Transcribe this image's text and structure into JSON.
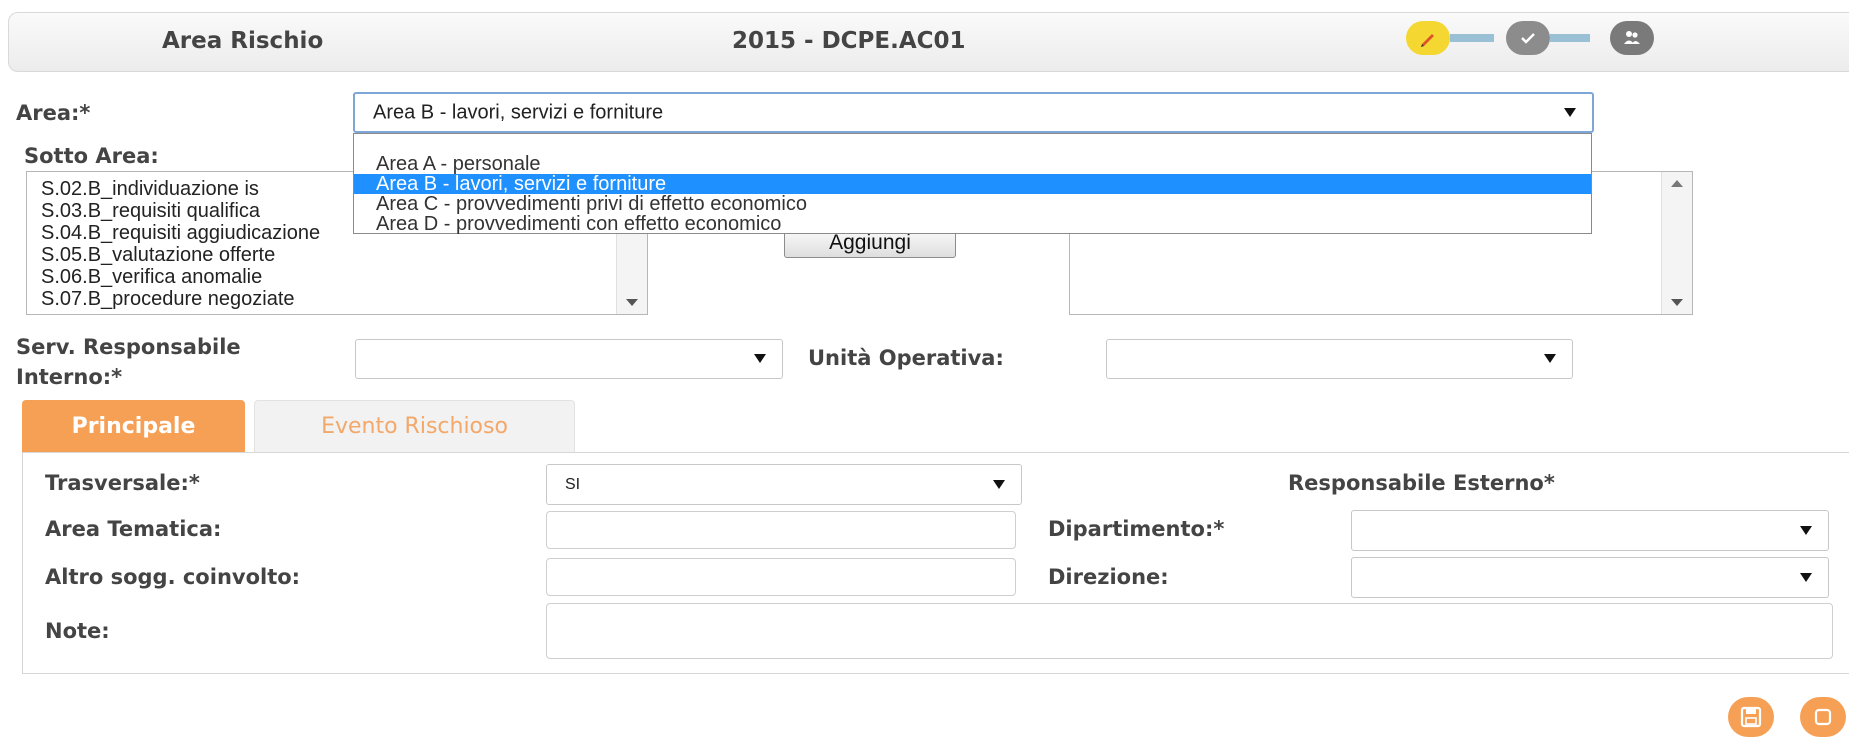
{
  "header": {
    "section_title": "Area Rischio",
    "code": "2015 - DCPE.AC01",
    "steps": [
      {
        "icon": "pencil-icon",
        "color": "#f4d730"
      },
      {
        "icon": "check-icon",
        "color": "#8c8c8c"
      },
      {
        "icon": "users-icon",
        "color": "#7a7a7a"
      }
    ]
  },
  "area": {
    "label": "Area:*",
    "selected": "Area B - lavori, servizi e forniture",
    "options": [
      "Area A - personale",
      "Area B - lavori, servizi e forniture",
      "Area C - provvedimenti privi di effetto economico",
      "Area D - provvedimenti con effetto economico"
    ]
  },
  "sotto_area": {
    "label": "Sotto Area:",
    "items": [
      "S.02.B_individuazione is",
      "S.03.B_requisiti qualifica",
      "S.04.B_requisiti aggiudicazione",
      "S.05.B_valutazione offerte",
      "S.06.B_verifica anomalie",
      "S.07.B_procedure negoziate"
    ],
    "add_button": "Aggiungi"
  },
  "serv_responsabile": {
    "label_line1": "Serv. Responsabile",
    "label_line2": "Interno:*",
    "value": ""
  },
  "unita_operativa": {
    "label": "Unità Operativa:",
    "value": ""
  },
  "tabs": [
    {
      "label": "Principale",
      "active": true
    },
    {
      "label": "Evento Rischioso",
      "active": false
    }
  ],
  "form": {
    "trasversale_label": "Trasversale:*",
    "trasversale_value": "SI",
    "responsabile_esterno_label": "Responsabile Esterno*",
    "area_tematica_label": "Area Tematica:",
    "area_tematica_value": "",
    "dipartimento_label": "Dipartimento:*",
    "dipartimento_value": "",
    "altro_label": "Altro sogg. coinvolto:",
    "altro_value": "",
    "direzione_label": "Direzione:",
    "direzione_value": "",
    "note_label": "Note:",
    "note_value": ""
  },
  "actions": [
    {
      "icon": "save-icon"
    },
    {
      "icon": "cancel-icon"
    }
  ],
  "colors": {
    "accent": "#f6a055",
    "selected_option": "#1e90ff",
    "step_active": "#f4d730",
    "step_inactive": "#8c8c8c"
  }
}
